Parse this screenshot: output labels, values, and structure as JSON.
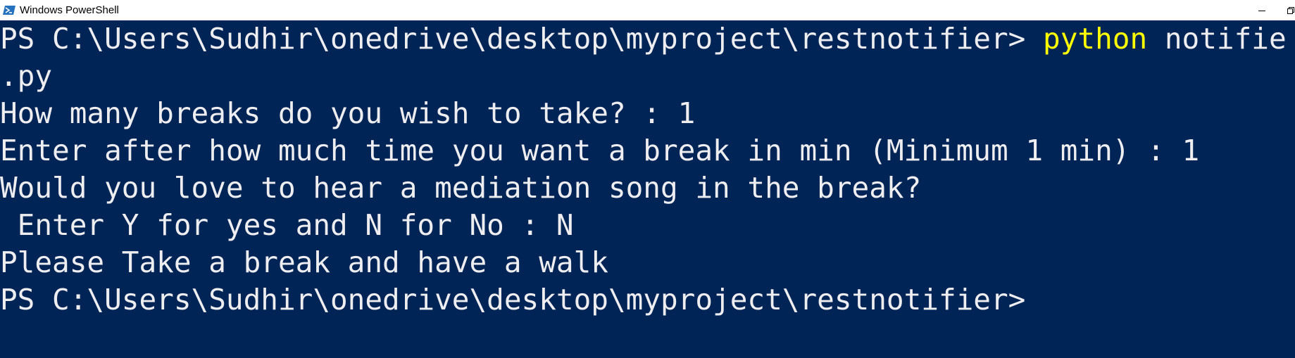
{
  "window": {
    "title": "Windows PowerShell",
    "icon": "powershell-icon",
    "controls": [
      "minimize-icon",
      "restore-icon"
    ]
  },
  "colors": {
    "background": "#012456",
    "foreground": "#eeedf0",
    "command": "#ffff00"
  },
  "console": {
    "prompt1": "PS C:\\Users\\Sudhir\\onedrive\\desktop\\myproject\\restnotifier> ",
    "command": "python",
    "argument_start": " notifie",
    "argument_wrap": ".py",
    "output": [
      "How many breaks do you wish to take? : 1",
      "Enter after how much time you want a break in min (Minimum 1 min) : 1",
      "Would you love to hear a mediation song in the break?",
      " Enter Y for yes and N for No : N",
      "Please Take a break and have a walk"
    ],
    "prompt2": "PS C:\\Users\\Sudhir\\onedrive\\desktop\\myproject\\restnotifier>"
  }
}
